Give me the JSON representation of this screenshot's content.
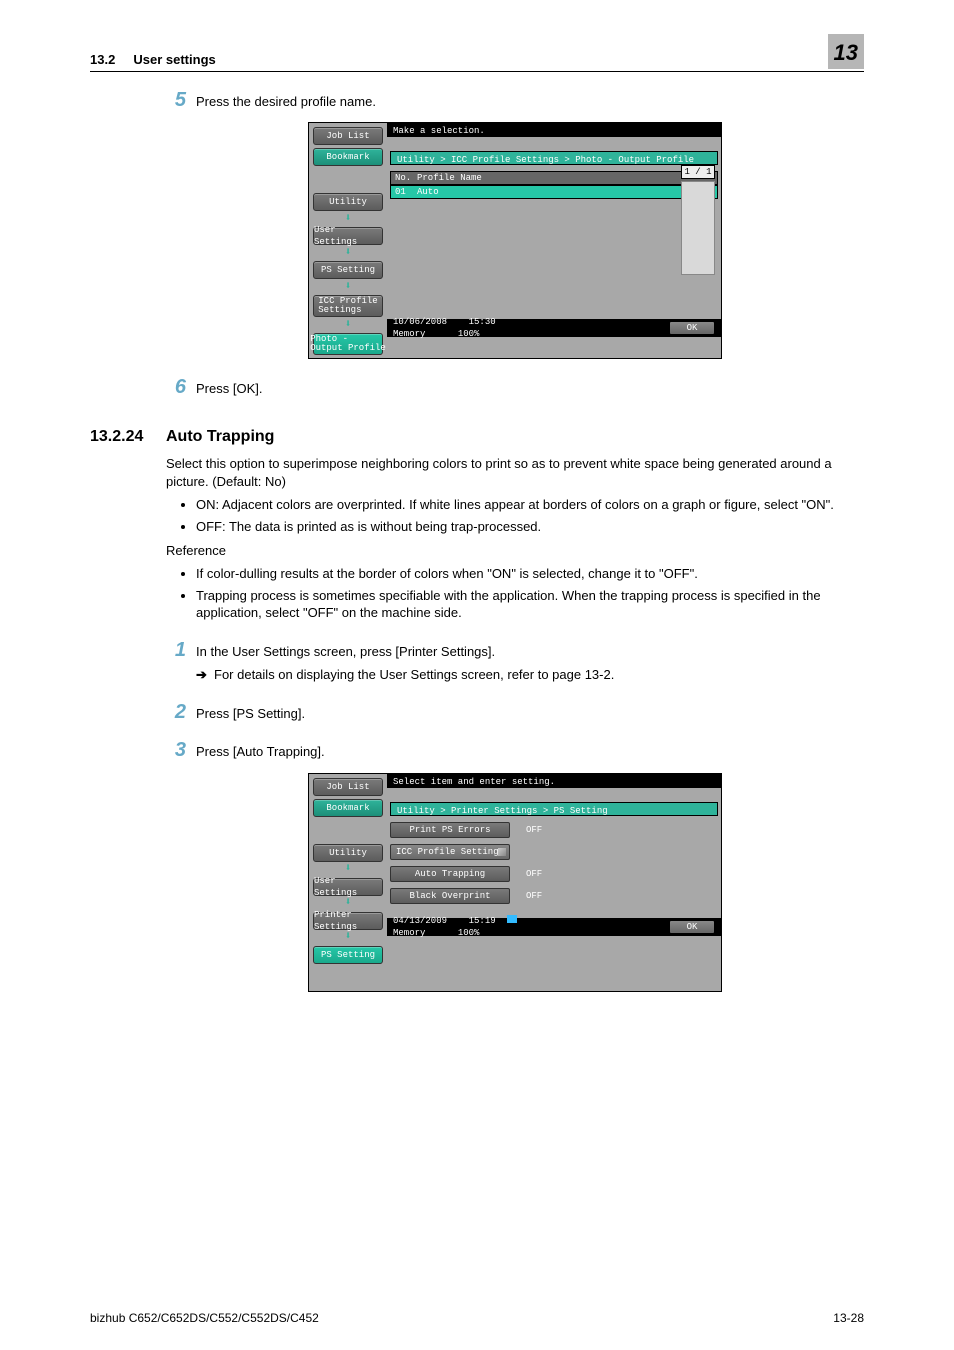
{
  "header": {
    "section": "13.2",
    "title": "User settings",
    "chapter": "13"
  },
  "steps_a": {
    "s5": {
      "num": "5",
      "text": "Press the desired profile name."
    },
    "s6": {
      "num": "6",
      "text": "Press [OK]."
    }
  },
  "section": {
    "num": "13.2.24",
    "title": "Auto Trapping",
    "intro": "Select this option to superimpose neighboring colors to print so as to prevent white space being generated around a picture. (Default: No)",
    "bul1": "ON: Adjacent colors are overprinted. If white lines appear at borders of colors on a graph or figure, select \"ON\".",
    "bul2": "OFF: The data is printed as is without being trap-processed.",
    "ref_label": "Reference",
    "ref1": "If color-dulling results at the border of colors when \"ON\" is selected, change it to \"OFF\".",
    "ref2": "Trapping process is sometimes specifiable with the application. When the trapping process is specified in the application, select \"OFF\" on the machine side."
  },
  "steps_b": {
    "s1": {
      "num": "1",
      "text": "In the User Settings screen, press [Printer Settings].",
      "sub": "For details on displaying the User Settings screen, refer to page 13-2."
    },
    "s2": {
      "num": "2",
      "text": "Press [PS Setting]."
    },
    "s3": {
      "num": "3",
      "text": "Press [Auto Trapping]."
    }
  },
  "shot1": {
    "side": {
      "job": "Job List",
      "bm": "Bookmark",
      "crumbs": [
        "Utility",
        "User Settings",
        "PS Setting",
        "ICC Profile\nSettings",
        "Photo -\nOutput Profile"
      ]
    },
    "top": "Make a selection.",
    "path": "Utility > ICC Profile Settings > Photo - Output Profile",
    "hdr_no": "No.",
    "hdr_name": "Profile Name",
    "row_no": "01",
    "row_name": "Auto",
    "pager": "1 /  1",
    "date": "10/06/2008",
    "time": "15:30",
    "mem_l": "Memory",
    "mem_v": "100%",
    "ok": "OK"
  },
  "shot2": {
    "side": {
      "job": "Job List",
      "bm": "Bookmark",
      "crumbs": [
        "Utility",
        "User Settings",
        "Printer Settings",
        "PS Setting"
      ]
    },
    "top": "Select item and enter setting.",
    "path": "Utility > Printer Settings > PS Setting",
    "opts": [
      {
        "label": "Print PS Errors",
        "value": "OFF"
      },
      {
        "label": "ICC Profile Settings",
        "value": "",
        "sub": true
      },
      {
        "label": "Auto Trapping",
        "value": "OFF"
      },
      {
        "label": "Black Overprint",
        "value": "OFF"
      }
    ],
    "date": "04/13/2009",
    "time": "15:19",
    "mem_l": "Memory",
    "mem_v": "100%",
    "ok": "OK"
  },
  "footer": {
    "left": "bizhub C652/C652DS/C552/C552DS/C452",
    "right": "13-28"
  }
}
